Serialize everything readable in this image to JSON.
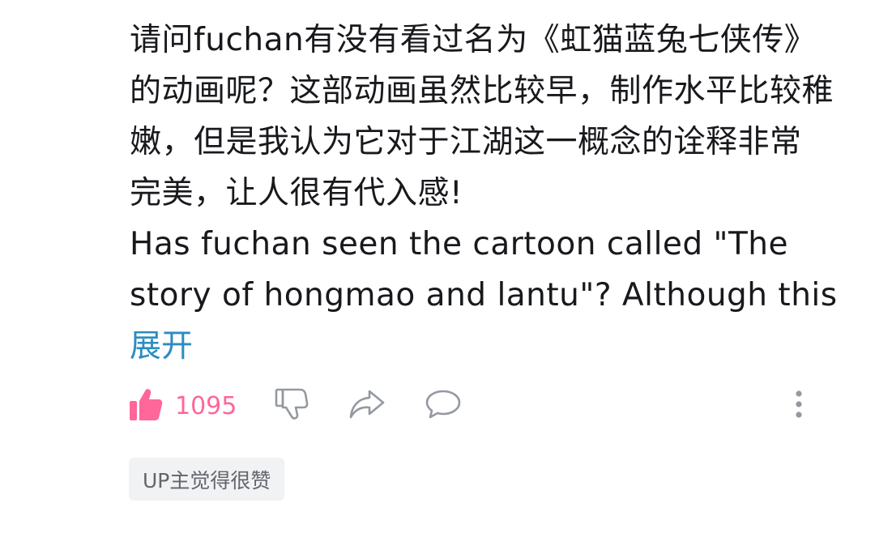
{
  "comment": {
    "lines": [
      "请问fuchan有没有看过名为《虹猫蓝兔七侠传》",
      "的动画呢？这部动画虽然比较早，制作水平比较稚",
      "嫩，但是我认为它对于江湖这一概念的诠释非常",
      "完美，让人很有代入感!",
      "Has fuchan seen the cartoon called \"The",
      "story of hongmao and lantu\"? Although this"
    ],
    "expand_label": "展开"
  },
  "actions": {
    "like_count": "1095",
    "like_color": "#ff6699",
    "icons": [
      "thumbs-up-icon",
      "thumbs-down-icon",
      "share-icon",
      "reply-icon",
      "more-icon"
    ]
  },
  "badge": {
    "label": "UP主觉得很赞"
  }
}
